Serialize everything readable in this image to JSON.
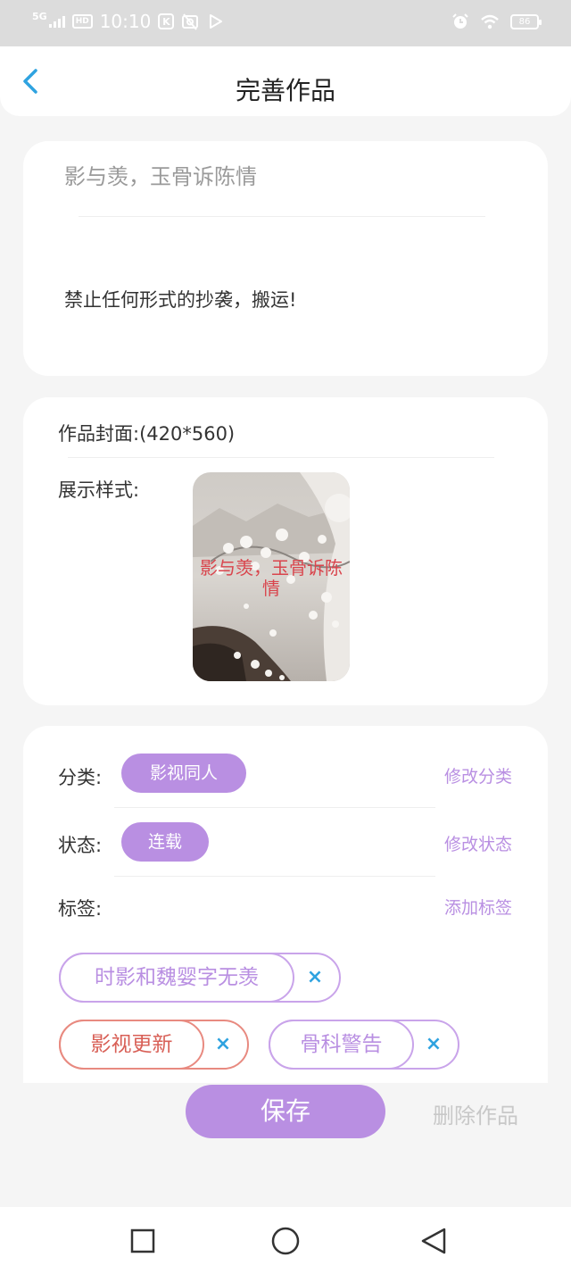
{
  "status_bar": {
    "network": "5G",
    "time": "10:10",
    "battery": "86",
    "icons": [
      "hd-icon",
      "k-app-icon",
      "no-photo-icon",
      "video-icon",
      "alarm-icon",
      "wifi-icon",
      "battery-icon"
    ]
  },
  "header": {
    "title": "完善作品",
    "back_icon": "chevron-left-icon"
  },
  "intro": {
    "work_title": "影与羡，玉骨诉陈情",
    "notice": "禁止任何形式的抄袭，搬运!"
  },
  "cover": {
    "cover_label": "作品封面:(420*560)",
    "style_label": "展示样式:",
    "cover_title": "影与羡，玉骨诉陈情"
  },
  "details": {
    "category_label": "分类:",
    "category_value": "影视同人",
    "edit_category": "修改分类",
    "status_label": "状态:",
    "status_value": "连载",
    "edit_status": "修改状态",
    "tags_label": "标签:",
    "add_tag": "添加标签",
    "tags": [
      "时影和魏婴字无羡",
      "影视更新",
      "骨科警告"
    ],
    "remove_icon": "×"
  },
  "actions": {
    "save": "保存",
    "delete": "删除作品"
  },
  "colors": {
    "accent": "#b98fe2",
    "blue": "#2fa3e0",
    "tag_red": "#e88a80"
  },
  "nav_bar": {
    "icons": [
      "recent-apps-icon",
      "home-icon",
      "back-icon"
    ]
  }
}
